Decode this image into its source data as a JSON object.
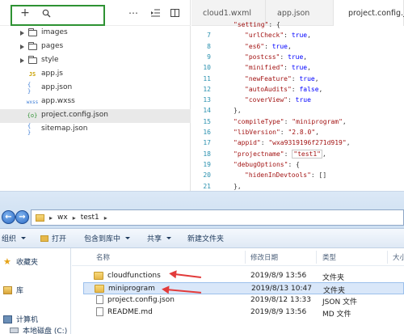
{
  "ide": {
    "toolbar": {
      "add_icon": "+",
      "search_icon": "search",
      "more_icon": "⋯",
      "outdent_icon": "⇤",
      "split_icon": "split"
    },
    "tree": [
      {
        "type": "folder",
        "name": "images"
      },
      {
        "type": "folder",
        "name": "pages"
      },
      {
        "type": "folder",
        "name": "style"
      },
      {
        "type": "js",
        "icon_text": "JS",
        "name": "app.js"
      },
      {
        "type": "json",
        "icon_text": "{ }",
        "name": "app.json"
      },
      {
        "type": "wxss",
        "icon_text": "wxss",
        "name": "app.wxss"
      },
      {
        "type": "config",
        "icon_text": "{o}",
        "name": "project.config.json"
      },
      {
        "type": "json",
        "icon_text": "{ }",
        "name": "sitemap.json"
      }
    ],
    "tabs": [
      "cloud1.wxml",
      "app.json",
      "project.config.json"
    ],
    "code_lines": [
      {
        "n": "",
        "text": "\"setting\": {"
      },
      {
        "n": "7",
        "text": "\"urlCheck\": true,"
      },
      {
        "n": "8",
        "text": "\"es6\": true,"
      },
      {
        "n": "9",
        "text": "\"postcss\": true,"
      },
      {
        "n": "10",
        "text": "\"minified\": true,"
      },
      {
        "n": "11",
        "text": "\"newFeature\": true,"
      },
      {
        "n": "12",
        "text": "\"autoAudits\": false,"
      },
      {
        "n": "13",
        "text": "\"coverView\": true"
      },
      {
        "n": "14",
        "text": "},"
      },
      {
        "n": "15",
        "text": "\"compileType\": \"miniprogram\","
      },
      {
        "n": "16",
        "text": "\"libVersion\": \"2.8.0\","
      },
      {
        "n": "17",
        "text": "\"appid\": \"wxa9319196f271d919\","
      },
      {
        "n": "18",
        "text": "\"projectname\": \"test1\","
      },
      {
        "n": "19",
        "text": "\"debugOptions\": {"
      },
      {
        "n": "20",
        "text": "\"hidenInDevtools\": []"
      },
      {
        "n": "21",
        "text": "},"
      }
    ]
  },
  "explorer": {
    "breadcrumb": [
      "wx",
      "test1"
    ],
    "commands": [
      "组织",
      "打开",
      "包含到库中",
      "共享",
      "新建文件夹"
    ],
    "nav": [
      "收藏夹",
      "库",
      "计算机",
      "本地磁盘 (C:)"
    ],
    "columns": [
      "名称",
      "修改日期",
      "类型",
      "大小"
    ],
    "files": [
      {
        "name": "cloudfunctions",
        "date": "2019/8/9 13:56",
        "type": "文件夹",
        "kind": "folder"
      },
      {
        "name": "miniprogram",
        "date": "2019/8/13 10:47",
        "type": "文件夹",
        "kind": "folder"
      },
      {
        "name": "project.config.json",
        "date": "2019/8/12 13:33",
        "type": "JSON 文件",
        "kind": "doc"
      },
      {
        "name": "README.md",
        "date": "2019/8/9 13:56",
        "type": "MD 文件",
        "kind": "doc"
      }
    ]
  },
  "colors": {
    "highlight_box": "#2e9233",
    "annotation_arrow": "#e23b3b",
    "code_string": "#a31515",
    "code_keyword": "#0000ff",
    "line_number": "#2b91af"
  }
}
